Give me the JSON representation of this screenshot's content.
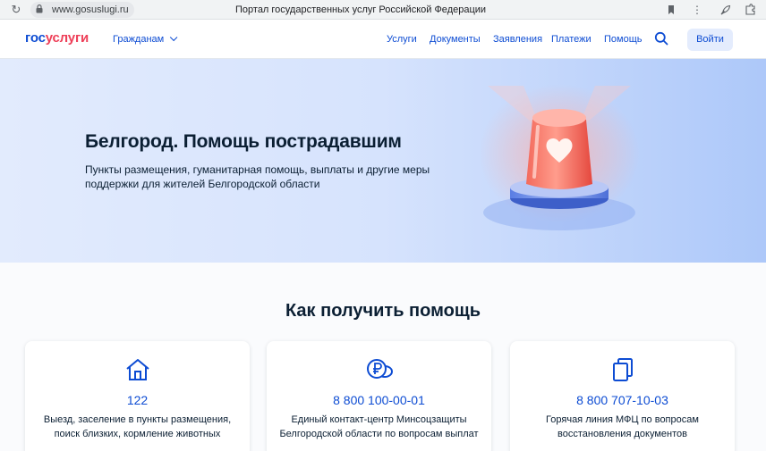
{
  "browser": {
    "url": "www.gosuslugi.ru",
    "window_title": "Портал государственных услуг Российской Федерации"
  },
  "header": {
    "logo_part1": "гос",
    "logo_part2": "услуги",
    "region": "Гражданам",
    "nav": [
      "Услуги",
      "Документы",
      "Заявления",
      "Платежи",
      "Помощь"
    ],
    "login": "Войти"
  },
  "hero": {
    "title": "Белгород. Помощь пострадавшим",
    "description": "Пункты размещения, гуманитарная помощь, выплаты и другие меры поддержки для жителей Белгородской области"
  },
  "help": {
    "title": "Как получить помощь",
    "cards": [
      {
        "icon": "house-icon",
        "phone": "122",
        "text": "Выезд, заселение в пункты размещения, поиск близких, кормление животных"
      },
      {
        "icon": "ruble-coin-icon",
        "phone": "8 800 100-00-01",
        "text": "Единый контакт-центр Минсоцзащиты Белгородской области по вопросам выплат"
      },
      {
        "icon": "documents-icon",
        "phone": "8 800 707-10-03",
        "text": "Горячая линия МФЦ по вопросам восстановления документов"
      }
    ]
  },
  "colors": {
    "brand_blue": "#0d4cd3",
    "brand_red": "#ee3f58",
    "text": "#0b1f33"
  }
}
